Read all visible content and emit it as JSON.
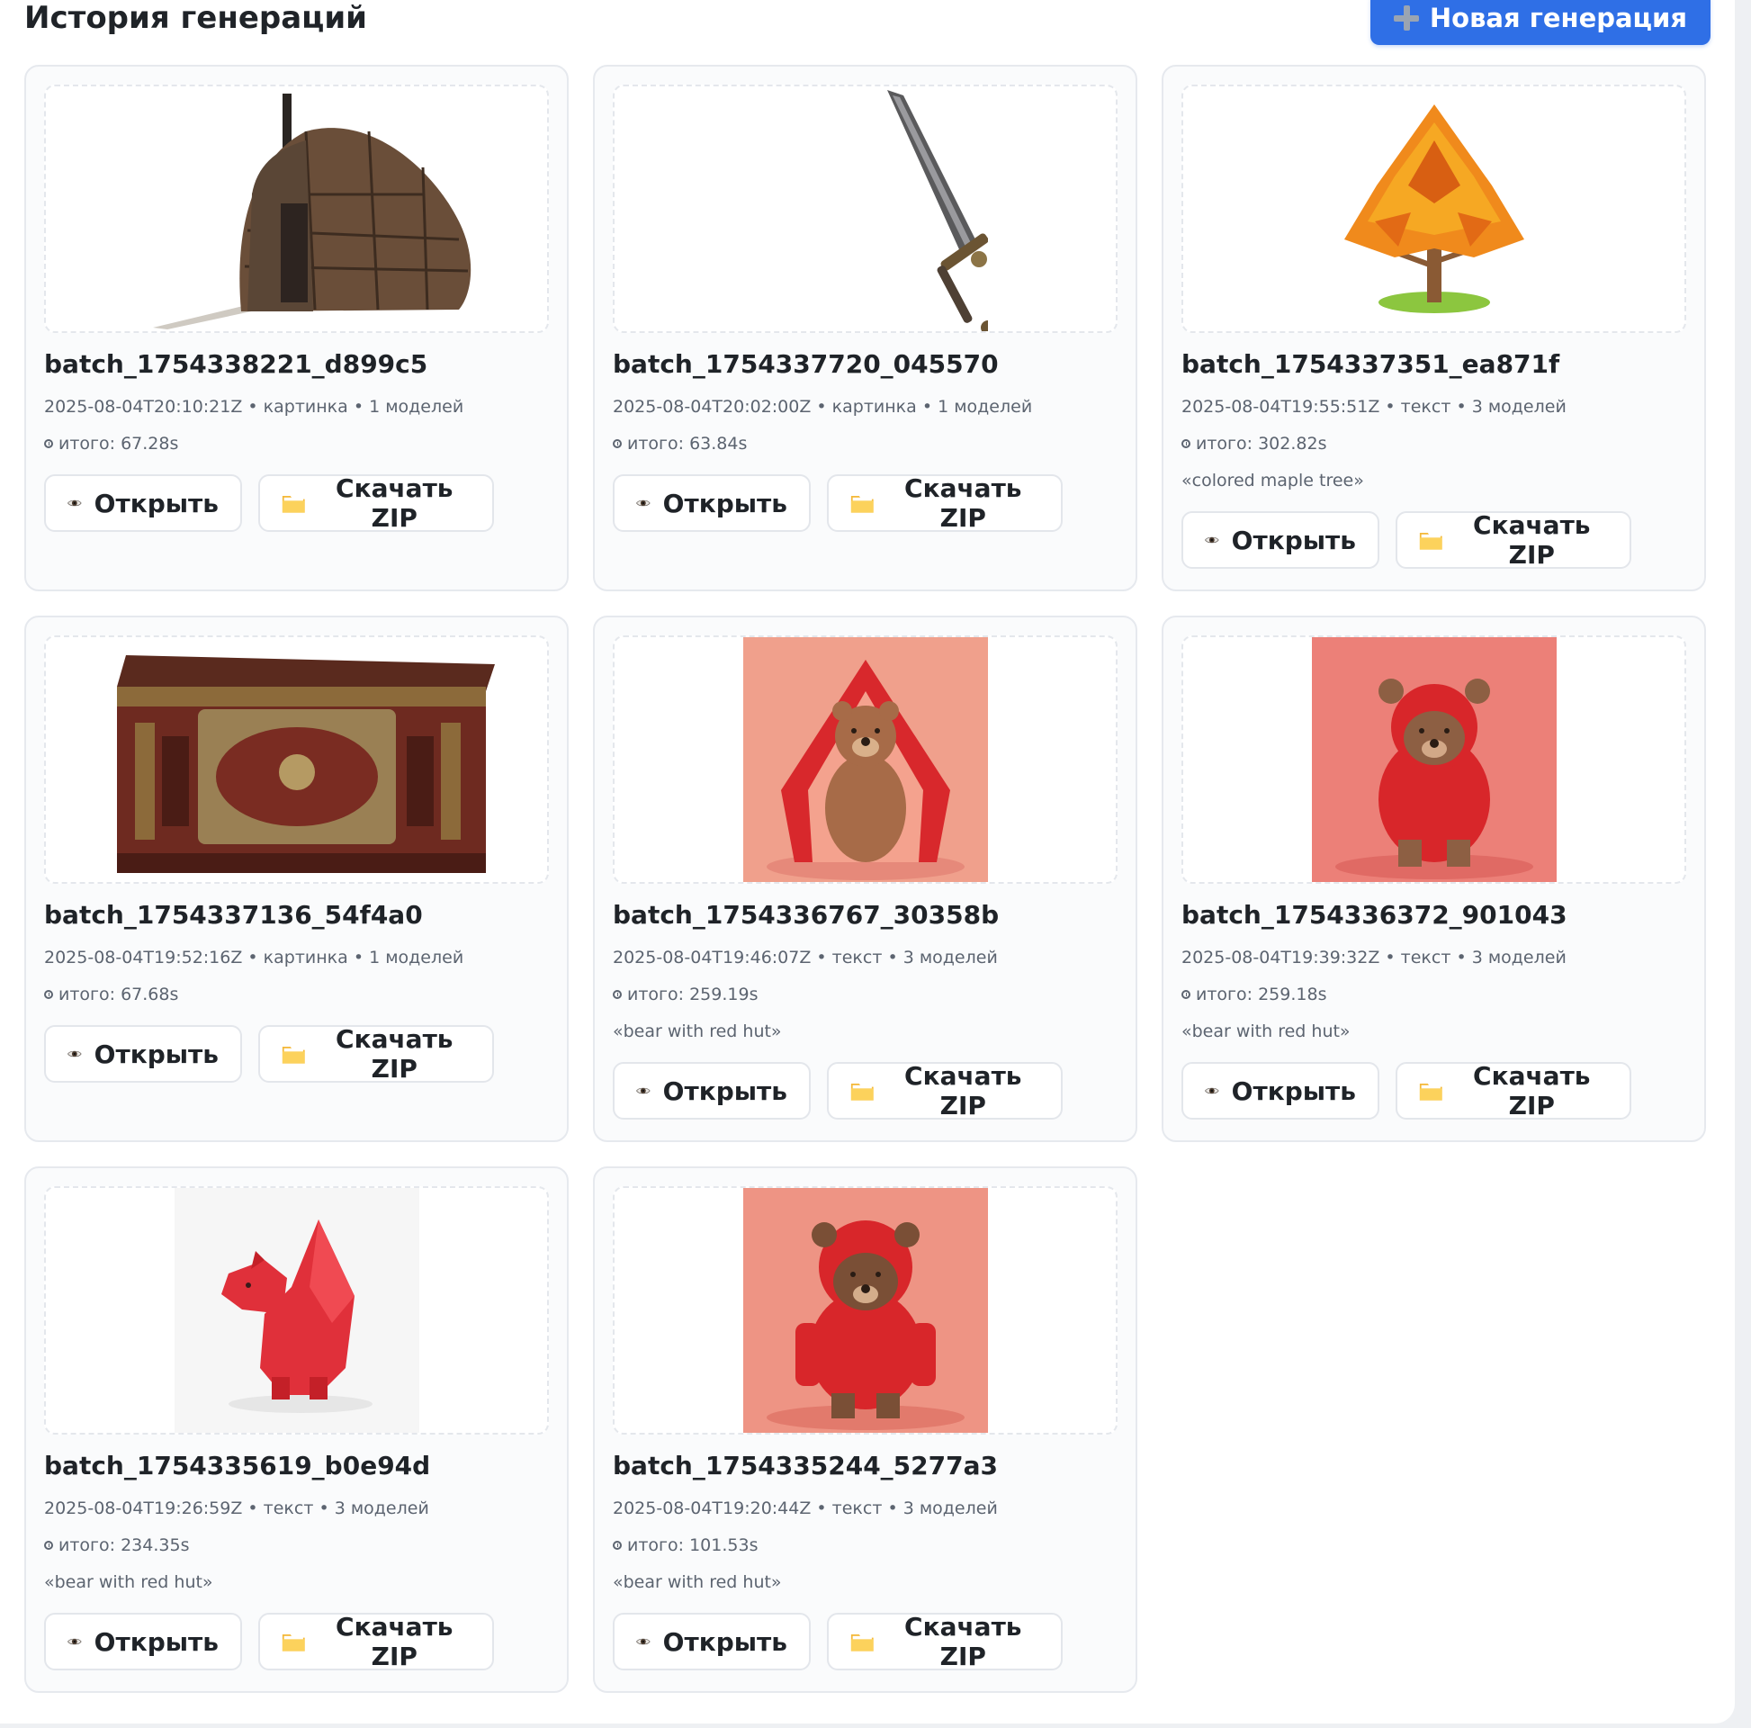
{
  "header": {
    "title": "История генераций",
    "new_button": "Новая генерация"
  },
  "labels": {
    "open": "Открыть",
    "zip": "Скачать ZIP"
  },
  "cards": [
    {
      "name": "batch_1754338221_d899c5",
      "meta": "2025-08-04T20:10:21Z • картинка • 1 моделей",
      "total": "итого: 67.28s",
      "prompt": "",
      "image": "hut-icon"
    },
    {
      "name": "batch_1754337720_045570",
      "meta": "2025-08-04T20:02:00Z • картинка • 1 моделей",
      "total": "итого: 63.84s",
      "prompt": "",
      "image": "sword-icon"
    },
    {
      "name": "batch_1754337351_ea871f",
      "meta": "2025-08-04T19:55:51Z • текст • 3 моделей",
      "total": "итого: 302.82s",
      "prompt": "«colored maple tree»",
      "image": "maple-tree-icon"
    },
    {
      "name": "batch_1754337136_54f4a0",
      "meta": "2025-08-04T19:52:16Z • картинка • 1 моделей",
      "total": "итого: 67.68s",
      "prompt": "",
      "image": "chest-icon"
    },
    {
      "name": "batch_1754336767_30358b",
      "meta": "2025-08-04T19:46:07Z • текст • 3 моделей",
      "total": "итого: 259.19s",
      "prompt": "«bear with red hut»",
      "image": "bear-in-hut-icon"
    },
    {
      "name": "batch_1754336372_901043",
      "meta": "2025-08-04T19:39:32Z • текст • 3 моделей",
      "total": "итого: 259.18s",
      "prompt": "«bear with red hut»",
      "image": "bear-red-hood-icon"
    },
    {
      "name": "batch_1754335619_b0e94d",
      "meta": "2025-08-04T19:26:59Z • текст • 3 моделей",
      "total": "итого: 234.35s",
      "prompt": "«bear with red hut»",
      "image": "red-polygon-bear-icon"
    },
    {
      "name": "batch_1754335244_5277a3",
      "meta": "2025-08-04T19:20:44Z • текст • 3 моделей",
      "total": "итого: 101.53s",
      "prompt": "«bear with red hut»",
      "image": "bear-red-hoodie-icon"
    }
  ],
  "colors": {
    "accent": "#2f6fe6",
    "card_bg": "#fafbfc",
    "card_border": "#e6e9ee",
    "muted_text": "#5c6470"
  }
}
